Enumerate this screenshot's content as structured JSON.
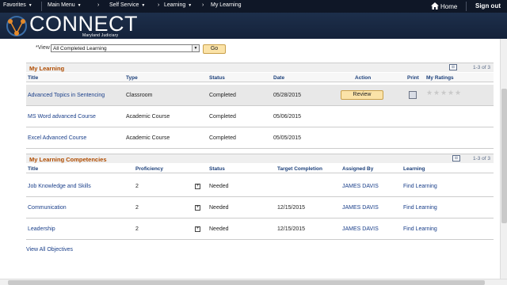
{
  "nav": {
    "favorites": "Favorites",
    "main_menu": "Main Menu",
    "self_service": "Self Service",
    "learning": "Learning",
    "breadcrumb_current": "My Learning",
    "home": "Home",
    "sign_out": "Sign out"
  },
  "brand": {
    "title": "CONNECT",
    "subtitle": "Maryland Judiciary"
  },
  "view": {
    "label": "*View",
    "selected": "All Completed Learning",
    "go": "Go"
  },
  "my_learning": {
    "title": "My Learning",
    "count": "1-3 of 3",
    "columns": [
      "Title",
      "Type",
      "Status",
      "Date",
      "Action",
      "Print",
      "My Ratings"
    ],
    "rows": [
      {
        "title": "Advanced Topics in Sentencing",
        "type": "Classroom",
        "status": "Completed",
        "date": "05/28/2015",
        "action": "Review"
      },
      {
        "title": "MS Word advanced Course",
        "type": "Academic Course",
        "status": "Completed",
        "date": "05/06/2015"
      },
      {
        "title": "Excel Advanced Course",
        "type": "Academic Course",
        "status": "Completed",
        "date": "05/05/2015"
      }
    ],
    "ratings": 0
  },
  "competencies": {
    "title": "My Learning Competencies",
    "count": "1-3 of 3",
    "columns": [
      "Title",
      "Proficiency",
      "Status",
      "Target Completion",
      "Assigned By",
      "Learning"
    ],
    "rows": [
      {
        "title": "Job Knowledge and Skills",
        "proficiency": "2",
        "status": "Needed",
        "target": "",
        "assigned_by": "JAMES DAVIS",
        "learning": "Find Learning"
      },
      {
        "title": "Communication",
        "proficiency": "2",
        "status": "Needed",
        "target": "12/15/2015",
        "assigned_by": "JAMES DAVIS",
        "learning": "Find Learning"
      },
      {
        "title": "Leadership",
        "proficiency": "2",
        "status": "Needed",
        "target": "12/15/2015",
        "assigned_by": "JAMES DAVIS",
        "learning": "Find Learning"
      }
    ]
  },
  "footer_link": "View All Objectives",
  "colors": {
    "nav_bg": "#0f1727",
    "banner_bg": "#1d2f4b",
    "section_title": "#b04c00",
    "link": "#1a3f8a",
    "button": "#fbe3a8",
    "highlight_row": "#e8e8e8"
  }
}
